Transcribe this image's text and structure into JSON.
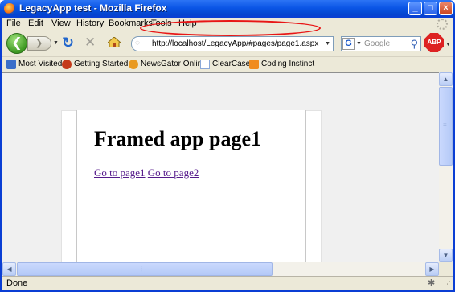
{
  "window": {
    "title": "LegacyApp test - Mozilla Firefox"
  },
  "menu": {
    "items": [
      {
        "pre": "",
        "u": "F",
        "post": "ile"
      },
      {
        "pre": "",
        "u": "E",
        "post": "dit"
      },
      {
        "pre": "",
        "u": "V",
        "post": "iew"
      },
      {
        "pre": "Hi",
        "u": "s",
        "post": "tory"
      },
      {
        "pre": "",
        "u": "B",
        "post": "ookmarks"
      },
      {
        "pre": "",
        "u": "T",
        "post": "ools"
      },
      {
        "pre": "",
        "u": "H",
        "post": "elp"
      }
    ]
  },
  "nav": {
    "url": "http://localhost/LegacyApp/#pages/page1.aspx",
    "search_placeholder": "Google",
    "adblock_label": "ABP"
  },
  "bookmarks": {
    "items": [
      {
        "label": "Most Visited",
        "icon": "most-visited-icon",
        "color": "#3a6ec9"
      },
      {
        "label": "Getting Started",
        "icon": "firefox-icon",
        "color": "#c43a1a"
      },
      {
        "label": "NewsGator Online",
        "icon": "newsgator-icon",
        "color": "#e99a1f"
      },
      {
        "label": "ClearCase",
        "icon": "page-icon",
        "color": "#8aa8d8"
      },
      {
        "label": "Coding Instinct",
        "icon": "rss-icon",
        "color": "#f08b1d"
      }
    ]
  },
  "content": {
    "heading": "Framed app page1",
    "links": [
      "Go to page1",
      "Go to page2"
    ]
  },
  "status": {
    "text": "Done"
  }
}
